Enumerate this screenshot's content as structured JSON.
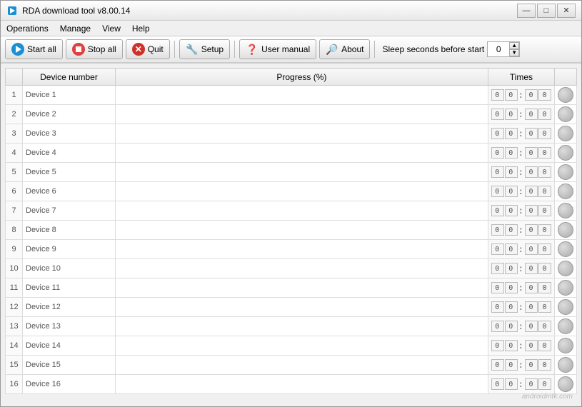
{
  "window": {
    "title": "RDA download tool v8.00.14",
    "min_label": "—",
    "max_label": "□",
    "close_label": "✕"
  },
  "menu": {
    "items": [
      {
        "label": "Operations"
      },
      {
        "label": "Manage"
      },
      {
        "label": "View"
      },
      {
        "label": "Help"
      }
    ]
  },
  "toolbar": {
    "start_all_label": "Start all",
    "stop_all_label": "Stop all",
    "quit_label": "Quit",
    "setup_label": "Setup",
    "manual_label": "User manual",
    "about_label": "About",
    "sleep_label": "Sleep seconds before start",
    "sleep_value": "0"
  },
  "table": {
    "col_device": "Device number",
    "col_progress": "Progress (%)",
    "col_times": "Times",
    "devices": [
      {
        "row": 1,
        "name": "Device 1"
      },
      {
        "row": 2,
        "name": "Device 2"
      },
      {
        "row": 3,
        "name": "Device 3"
      },
      {
        "row": 4,
        "name": "Device 4"
      },
      {
        "row": 5,
        "name": "Device 5"
      },
      {
        "row": 6,
        "name": "Device 6"
      },
      {
        "row": 7,
        "name": "Device 7"
      },
      {
        "row": 8,
        "name": "Device 8"
      },
      {
        "row": 9,
        "name": "Device 9"
      },
      {
        "row": 10,
        "name": "Device 10"
      },
      {
        "row": 11,
        "name": "Device 11"
      },
      {
        "row": 12,
        "name": "Device 12"
      },
      {
        "row": 13,
        "name": "Device 13"
      },
      {
        "row": 14,
        "name": "Device 14"
      },
      {
        "row": 15,
        "name": "Device 15"
      },
      {
        "row": 16,
        "name": "Device 16"
      }
    ]
  },
  "watermark": "androidmtk.com"
}
